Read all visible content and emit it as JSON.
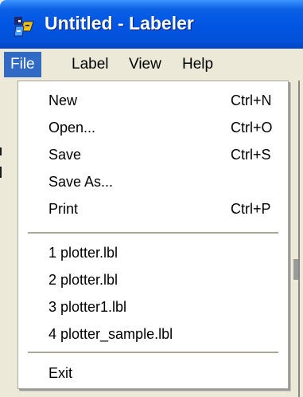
{
  "window": {
    "title": "Untitled - Labeler",
    "icon": "labeler-app-icon"
  },
  "menubar": {
    "items": [
      {
        "label": "File",
        "active": true
      },
      {
        "label": "Label",
        "active": false
      },
      {
        "label": "View",
        "active": false
      },
      {
        "label": "Help",
        "active": false
      }
    ]
  },
  "file_menu": {
    "items": [
      {
        "label": "New",
        "shortcut": "Ctrl+N"
      },
      {
        "label": "Open...",
        "shortcut": "Ctrl+O"
      },
      {
        "label": "Save",
        "shortcut": "Ctrl+S"
      },
      {
        "label": "Save As...",
        "shortcut": ""
      },
      {
        "label": "Print",
        "shortcut": "Ctrl+P"
      }
    ],
    "recent_files": [
      {
        "label": "1 plotter.lbl"
      },
      {
        "label": "2 plotter.lbl"
      },
      {
        "label": "3 plotter1.lbl"
      },
      {
        "label": "4 plotter_sample.lbl"
      }
    ],
    "exit": {
      "label": "Exit"
    }
  },
  "colors": {
    "titlebar": "#0054e3",
    "menu_highlight": "#316ac5",
    "menu_background": "#ffffff",
    "chrome": "#ece9d8",
    "separator": "#aca899"
  }
}
